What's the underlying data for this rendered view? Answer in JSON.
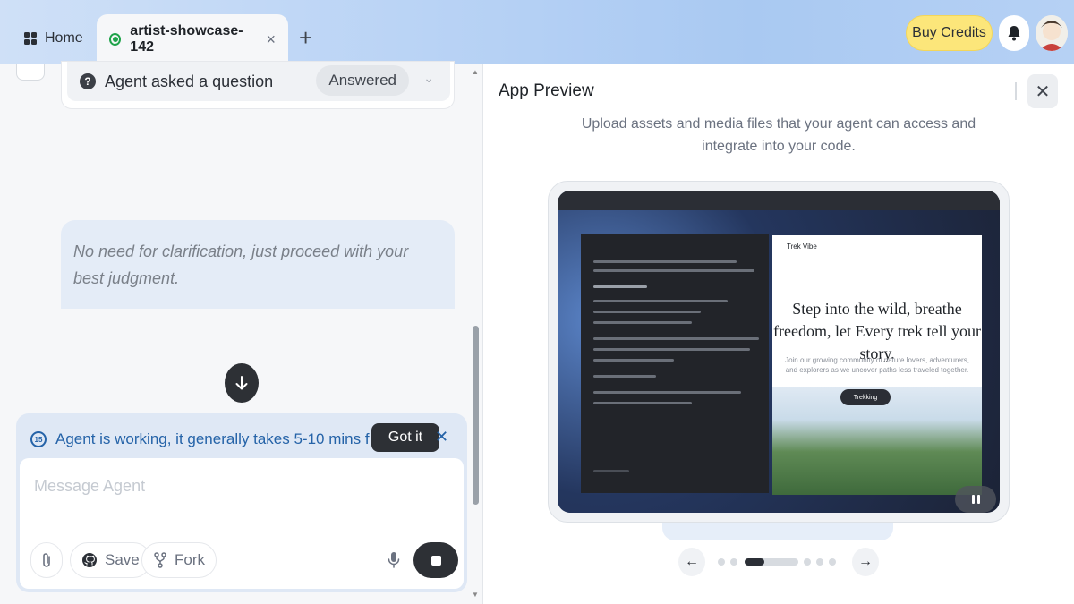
{
  "tabs": {
    "home_label": "Home",
    "active_label": "artist-showcase-142",
    "close_glyph": "×",
    "new_tab_glyph": "+"
  },
  "header": {
    "buy_credits": "Buy Credits"
  },
  "chat": {
    "question_label": "Agent asked a question",
    "question_status": "Answered",
    "user_message": "No need for clarification, just proceed with your best judgment.",
    "working_text": "Agent is working, it generally takes 5-10 mins f...",
    "working_icon_text": "15",
    "got_it": "Got it",
    "message_placeholder": "Message Agent",
    "save_label": "Save",
    "fork_label": "Fork"
  },
  "preview": {
    "title": "App Preview",
    "description": "Upload assets and media files that your agent can access and integrate into your code.",
    "screen_hero": "Step into the wild, breathe freedom, let Every trek tell your story.",
    "screen_sub": "Join our growing community of nature lovers, adventurers, and explorers as we uncover paths less traveled together.",
    "screen_brand": "Trek Vibe",
    "screen_cta": "Trekking",
    "pager_total": 8,
    "pager_active": 3
  },
  "colors": {
    "accent_blue": "#2563a8",
    "credits_yellow": "#fce67a",
    "status_green": "#1fa34a"
  }
}
